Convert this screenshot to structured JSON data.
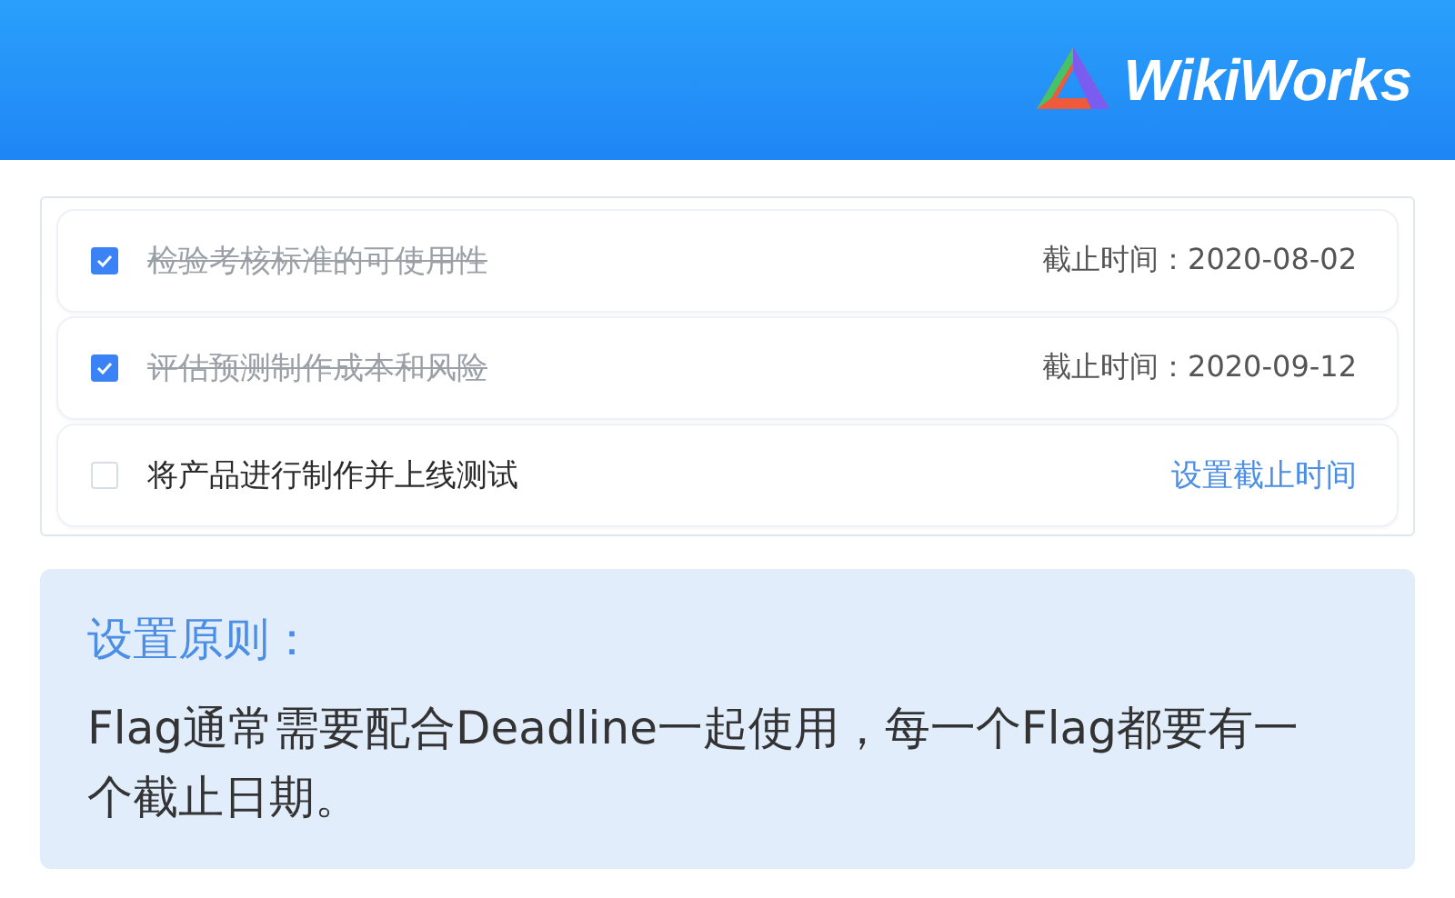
{
  "header": {
    "logo_text": "WikiWorks"
  },
  "tasks": [
    {
      "title": "检验考核标准的可使用性",
      "checked": true,
      "kind": "deadline",
      "deadline": "截止时间：2020-08-02"
    },
    {
      "title": "评估预测制作成本和风险",
      "checked": true,
      "kind": "deadline",
      "deadline": "截止时间：2020-09-12"
    },
    {
      "title": "将产品进行制作并上线测试",
      "checked": false,
      "kind": "action",
      "action": "设置截止时间"
    }
  ],
  "note": {
    "title": "设置原则：",
    "body": "Flag通常需要配合Deadline一起使用，每一个Flag都要有一个截止日期。"
  }
}
